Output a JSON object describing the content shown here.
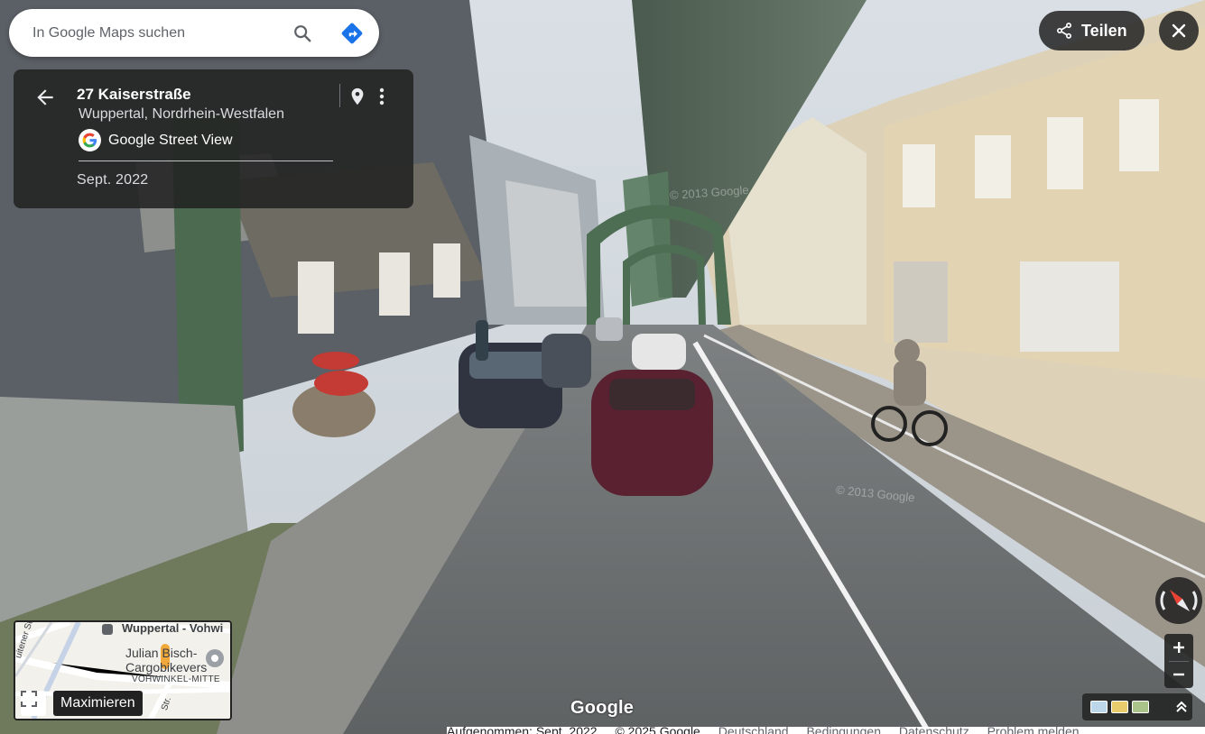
{
  "search": {
    "placeholder": "In Google Maps suchen"
  },
  "icons": {
    "search": "search-icon",
    "directions": "directions-icon",
    "back": "arrow-left-icon",
    "pin": "map-pin-icon",
    "more": "more-vertical-icon",
    "share": "share-icon",
    "close": "close-icon",
    "compass": "compass-icon",
    "zoom_in": "plus-icon",
    "zoom_out": "minus-icon",
    "fullscreen": "fullscreen-icon",
    "expand": "chevron-double-up-icon"
  },
  "info_panel": {
    "title": "27 Kaiserstraße",
    "subtitle": "Wuppertal, Nordrhein-Westfalen",
    "provider": "Google Street View",
    "date": "Sept. 2022"
  },
  "top_right": {
    "share_label": "Teilen"
  },
  "minimap": {
    "label_station": "Wuppertal - Vohwi",
    "label_poi_1": "Julian Bisch-",
    "label_poi_2": "Cargobikevers",
    "label_district": "VOHWINKEL-MITTE",
    "label_street_1": "uitener Str.",
    "label_street_2": "Str.",
    "maximize_label": "Maximieren"
  },
  "footer": {
    "google_logo": "Google",
    "captured": "Aufgenommen: Sept. 2022",
    "copyright": "© 2025 Google",
    "links": [
      "Deutschland",
      "Bedingungen",
      "Datenschutz",
      "Problem melden"
    ]
  },
  "watermarks": [
    "© 2013 Google",
    "© 2013 Google"
  ],
  "colors": {
    "panel_bg": "#222222",
    "directions_accent": "#1a73e8",
    "compass_north": "#ea4335"
  }
}
